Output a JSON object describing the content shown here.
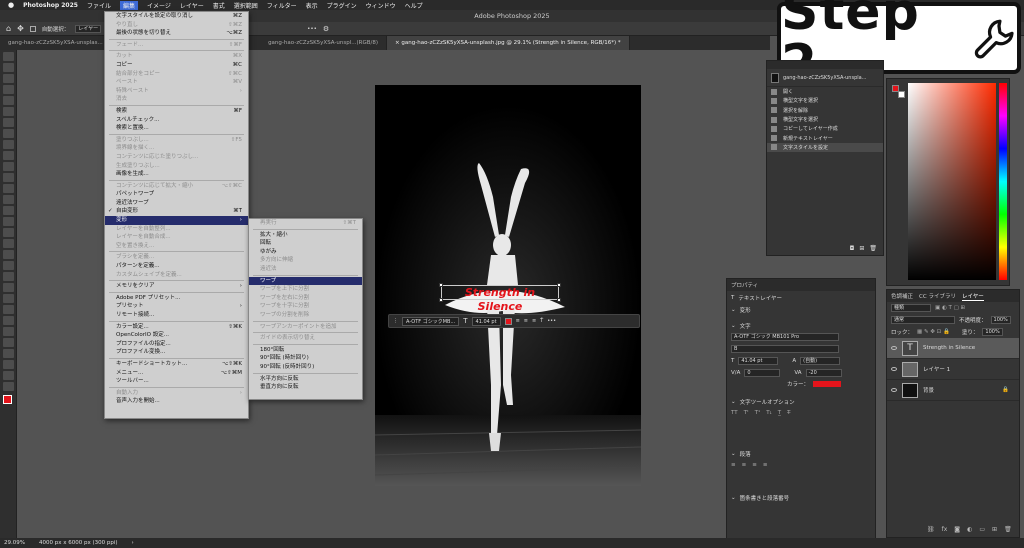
{
  "menubar": {
    "apple": "",
    "app_name": "Photoshop 2025",
    "items": [
      "ファイル",
      "編集",
      "イメージ",
      "レイヤー",
      "書式",
      "選択範囲",
      "フィルター",
      "表示",
      "プラグイン",
      "ウィンドウ",
      "ヘルプ"
    ],
    "active_index": 1
  },
  "window_title": "Adobe Photoshop 2025",
  "optionsbar": {
    "auto_select": "自動選択：",
    "target": "レイヤー",
    "more": "•••"
  },
  "tabs": [
    {
      "label": "gang-hao-zCZzSK5yXSA-unsplas..."
    },
    {
      "label": "gang-hao-zCZzSK5yXSA-unspl...(RGB/8)"
    },
    {
      "label": "gang-hao-zCZzSK5yXSA-unsplash.jpg @ 29.1% (Strength in Silence, RGB/16*) *"
    }
  ],
  "step_badge": {
    "text": "Step 2"
  },
  "edit_menu": [
    {
      "label": "文字スタイルを設定の取り消し",
      "shortcut": "⌘Z",
      "disabled": false
    },
    {
      "label": "やり直し",
      "shortcut": "⇧⌘Z",
      "disabled": true
    },
    {
      "label": "最後の状態を切り替え",
      "shortcut": "⌥⌘Z",
      "disabled": false
    },
    {
      "sep": true
    },
    {
      "label": "フェード...",
      "shortcut": "⇧⌘F",
      "disabled": true
    },
    {
      "sep": true
    },
    {
      "label": "カット",
      "shortcut": "⌘X",
      "disabled": true
    },
    {
      "label": "コピー",
      "shortcut": "⌘C",
      "disabled": false
    },
    {
      "label": "結合部分をコピー",
      "shortcut": "⇧⌘C",
      "disabled": true
    },
    {
      "label": "ペースト",
      "shortcut": "⌘V",
      "disabled": true
    },
    {
      "label": "特殊ペースト",
      "shortcut": "›",
      "disabled": true
    },
    {
      "label": "消去",
      "shortcut": "",
      "disabled": true
    },
    {
      "sep": true
    },
    {
      "label": "検索",
      "shortcut": "⌘F",
      "disabled": false
    },
    {
      "label": "スペルチェック...",
      "shortcut": "",
      "disabled": false
    },
    {
      "label": "検索と置換...",
      "shortcut": "",
      "disabled": false
    },
    {
      "sep": true
    },
    {
      "label": "塗りつぶし...",
      "shortcut": "⇧F5",
      "disabled": true
    },
    {
      "label": "境界線を描く...",
      "shortcut": "",
      "disabled": true
    },
    {
      "label": "コンテンツに応じた塗りつぶし...",
      "shortcut": "",
      "disabled": true
    },
    {
      "label": "生成塗りつぶし...",
      "shortcut": "",
      "disabled": true
    },
    {
      "label": "画像を生成...",
      "shortcut": "",
      "disabled": false
    },
    {
      "sep": true
    },
    {
      "label": "コンテンツに応じて拡大・縮小",
      "shortcut": "⌥⇧⌘C",
      "disabled": true
    },
    {
      "label": "パペットワープ",
      "shortcut": "",
      "disabled": false
    },
    {
      "label": "遠近法ワープ",
      "shortcut": "",
      "disabled": false
    },
    {
      "label": "自由変形",
      "shortcut": "⌘T",
      "disabled": false,
      "checked": true
    },
    {
      "label": "変形",
      "shortcut": "›",
      "disabled": false,
      "highlight": true
    },
    {
      "label": "レイヤーを自動整列...",
      "shortcut": "",
      "disabled": true
    },
    {
      "label": "レイヤーを自動合成...",
      "shortcut": "",
      "disabled": true
    },
    {
      "label": "空を置き換え...",
      "shortcut": "",
      "disabled": true
    },
    {
      "sep": true
    },
    {
      "label": "ブラシを定義...",
      "shortcut": "",
      "disabled": true
    },
    {
      "label": "パターンを定義...",
      "shortcut": "",
      "disabled": false
    },
    {
      "label": "カスタムシェイプを定義...",
      "shortcut": "",
      "disabled": true
    },
    {
      "sep": true
    },
    {
      "label": "メモリをクリア",
      "shortcut": "›",
      "disabled": false
    },
    {
      "sep": true
    },
    {
      "label": "Adobe PDF プリセット...",
      "shortcut": "",
      "disabled": false
    },
    {
      "label": "プリセット",
      "shortcut": "›",
      "disabled": false
    },
    {
      "label": "リモート接続...",
      "shortcut": "",
      "disabled": false
    },
    {
      "sep": true
    },
    {
      "label": "カラー設定...",
      "shortcut": "⇧⌘K",
      "disabled": false
    },
    {
      "label": "OpenColorIO 設定...",
      "shortcut": "",
      "disabled": false
    },
    {
      "label": "プロファイルの指定...",
      "shortcut": "",
      "disabled": false
    },
    {
      "label": "プロファイル変換...",
      "shortcut": "",
      "disabled": false
    },
    {
      "sep": true
    },
    {
      "label": "キーボードショートカット...",
      "shortcut": "⌥⇧⌘K",
      "disabled": false
    },
    {
      "label": "メニュー...",
      "shortcut": "⌥⇧⌘M",
      "disabled": false
    },
    {
      "label": "ツールバー...",
      "shortcut": "",
      "disabled": false
    },
    {
      "sep": true
    },
    {
      "label": "自動入力",
      "shortcut": "›",
      "disabled": true
    },
    {
      "label": "音声入力を開始...",
      "shortcut": "",
      "disabled": false
    }
  ],
  "transform_menu": [
    {
      "label": "再実行",
      "shortcut": "⇧⌘T",
      "disabled": true
    },
    {
      "sep": true
    },
    {
      "label": "拡大・縮小",
      "disabled": false
    },
    {
      "label": "回転",
      "disabled": false
    },
    {
      "label": "ゆがみ",
      "disabled": false
    },
    {
      "label": "多方向に伸縮",
      "disabled": true
    },
    {
      "label": "遠近法",
      "disabled": true
    },
    {
      "sep": true
    },
    {
      "label": "ワープ",
      "disabled": false,
      "highlight": true
    },
    {
      "label": "ワープを上下に分割",
      "disabled": true
    },
    {
      "label": "ワープを左右に分割",
      "disabled": true
    },
    {
      "label": "ワープを十字に分割",
      "disabled": true
    },
    {
      "label": "ワープの分割を削除",
      "disabled": true
    },
    {
      "sep": true
    },
    {
      "label": "ワープアンカーポイントを追加",
      "disabled": true
    },
    {
      "sep": true
    },
    {
      "label": "ガイドの表示切り替え",
      "disabled": true
    },
    {
      "sep": true
    },
    {
      "label": "180°回転",
      "disabled": false
    },
    {
      "label": "90°回転 (時計回り)",
      "disabled": false
    },
    {
      "label": "90°回転 (反時計回り)",
      "disabled": false
    },
    {
      "sep": true
    },
    {
      "label": "水平方向に反転",
      "disabled": false
    },
    {
      "label": "垂直方向に反転",
      "disabled": false
    }
  ],
  "canvas_text": "Strength in Silence",
  "context_bar": {
    "font": "A-OTF ゴシックMB...",
    "size": "41.04 pt"
  },
  "history": {
    "doc": "gang-hao-zCZzSK5yXSA-unspla...",
    "items": [
      "開く",
      "横型文字を選択",
      "選択を解除",
      "横型文字を選択",
      "コピーしてレイヤー作成",
      "新規テキストレイヤー",
      "文字スタイルを設定"
    ]
  },
  "properties": {
    "tab": "プロパティ",
    "type": "テキストレイヤー",
    "section_transform": "変形",
    "section_char": "文字",
    "font": "A-OTF ゴシック MB101 Pro",
    "style": "B",
    "size": "41.04 pt",
    "leading": "(自動)",
    "va": "0",
    "tracking": "-20",
    "color_label": "カラー：",
    "section_textopts": "文字ツールオプション",
    "section_para": "段落",
    "section_bullets": "箇条書きと段落番号"
  },
  "layers": {
    "tabs": [
      "色調補正",
      "CC ライブラリ",
      "レイヤー"
    ],
    "kind": "種類",
    "blend": "通常",
    "opacity_label": "不透明度：",
    "opacity": "100%",
    "lock_label": "ロック：",
    "fill_label": "塗り：",
    "fill": "100%",
    "items": [
      {
        "name": "Strength in Silence",
        "kind": "T"
      },
      {
        "name": "レイヤー 1",
        "kind": "img"
      },
      {
        "name": "背景",
        "kind": "bg"
      }
    ]
  },
  "status": {
    "zoom": "29.09%",
    "size": "4000 px x 6000 px (300 ppi)"
  },
  "colors": {
    "accent": "#252c6c",
    "text_red": "#e4141b",
    "fg": "#e4141b",
    "bg": "#ffffff"
  }
}
